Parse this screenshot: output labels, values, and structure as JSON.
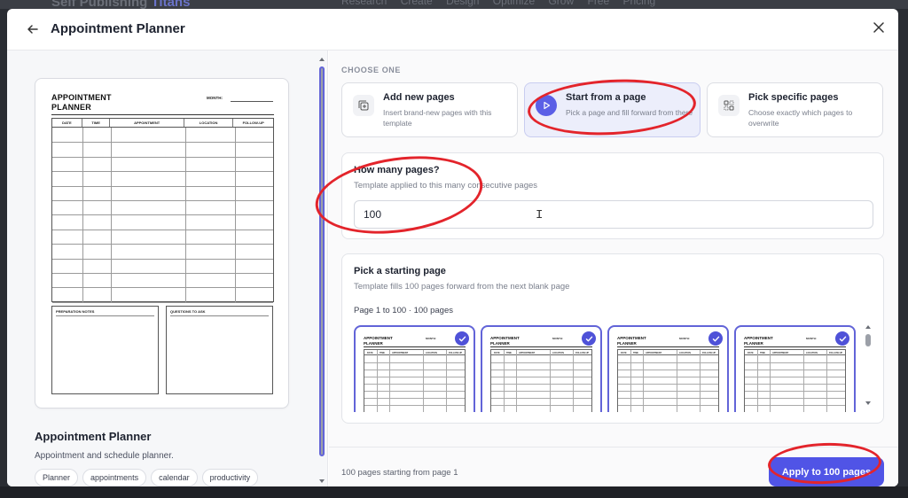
{
  "background": {
    "brand": "Self Publishing",
    "brand_accent": "Titans",
    "nav": [
      "Research",
      "Create",
      "Design",
      "Optimize",
      "Grow",
      "Free",
      "Pricing"
    ]
  },
  "modal": {
    "title": "Appointment Planner",
    "back_icon": "arrow-left-icon",
    "close_icon": "close-icon"
  },
  "preview": {
    "doc_title": "APPOINTMENT PLANNER",
    "month_label": "MONTH:",
    "columns": [
      "DATE",
      "TIME",
      "APPOINTMENT",
      "LOCATION",
      "FOLLOW-UP"
    ],
    "box_left": "PREPARATION NOTES",
    "box_right": "QUESTIONS TO ASK"
  },
  "template": {
    "name": "Appointment Planner",
    "description": "Appointment and schedule planner.",
    "tags": [
      "Planner",
      "appointments",
      "calendar",
      "productivity"
    ]
  },
  "choose": {
    "label": "CHOOSE ONE",
    "options": [
      {
        "title": "Add new pages",
        "desc": "Insert brand-new pages with this template",
        "icon": "add-page-icon",
        "selected": false
      },
      {
        "title": "Start from a page",
        "desc": "Pick a page and fill forward from there",
        "icon": "play-icon",
        "selected": true
      },
      {
        "title": "Pick specific pages",
        "desc": "Choose exactly which pages to overwrite",
        "icon": "grid-select-icon",
        "selected": false
      }
    ]
  },
  "how_many": {
    "title": "How many pages?",
    "desc": "Template applied to this many consecutive pages",
    "value": "100"
  },
  "starting_page": {
    "title": "Pick a starting page",
    "desc": "Template fills 100 pages forward from the next blank page",
    "range": "Page 1 to 100 · 100 pages",
    "thumb_title": "APPOINTMENT PLANNER",
    "thumb_month": "MONTH:",
    "thumb_columns": [
      "DATE",
      "TIME",
      "APPOINTMENT",
      "LOCATION",
      "FOLLOW-UP"
    ]
  },
  "footer": {
    "summary": "100 pages starting from page 1",
    "apply_label": "Apply to 100 pages"
  },
  "colors": {
    "accent": "#5054e6",
    "selected_bg": "#eceefb",
    "annotation": "#e3242b"
  }
}
